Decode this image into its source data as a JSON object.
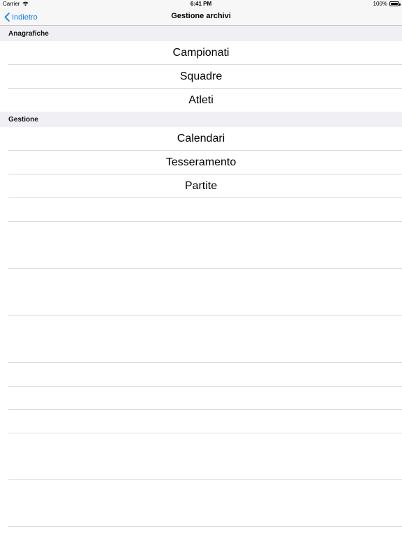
{
  "status_bar": {
    "carrier": "Carrier",
    "time": "6:41 PM",
    "battery": "100%",
    "battery_level": 1.0
  },
  "nav": {
    "back_label": "Indietro",
    "title": "Gestione archivi",
    "back_icon": "chevron-left-icon",
    "accent_color": "#147efb"
  },
  "sections": [
    {
      "header": "Anagrafiche",
      "items": [
        "Campionati",
        "Squadre",
        "Atleti"
      ]
    },
    {
      "header": "Gestione",
      "items": [
        "Calendari",
        "Tesseramento",
        "Partite"
      ]
    }
  ]
}
